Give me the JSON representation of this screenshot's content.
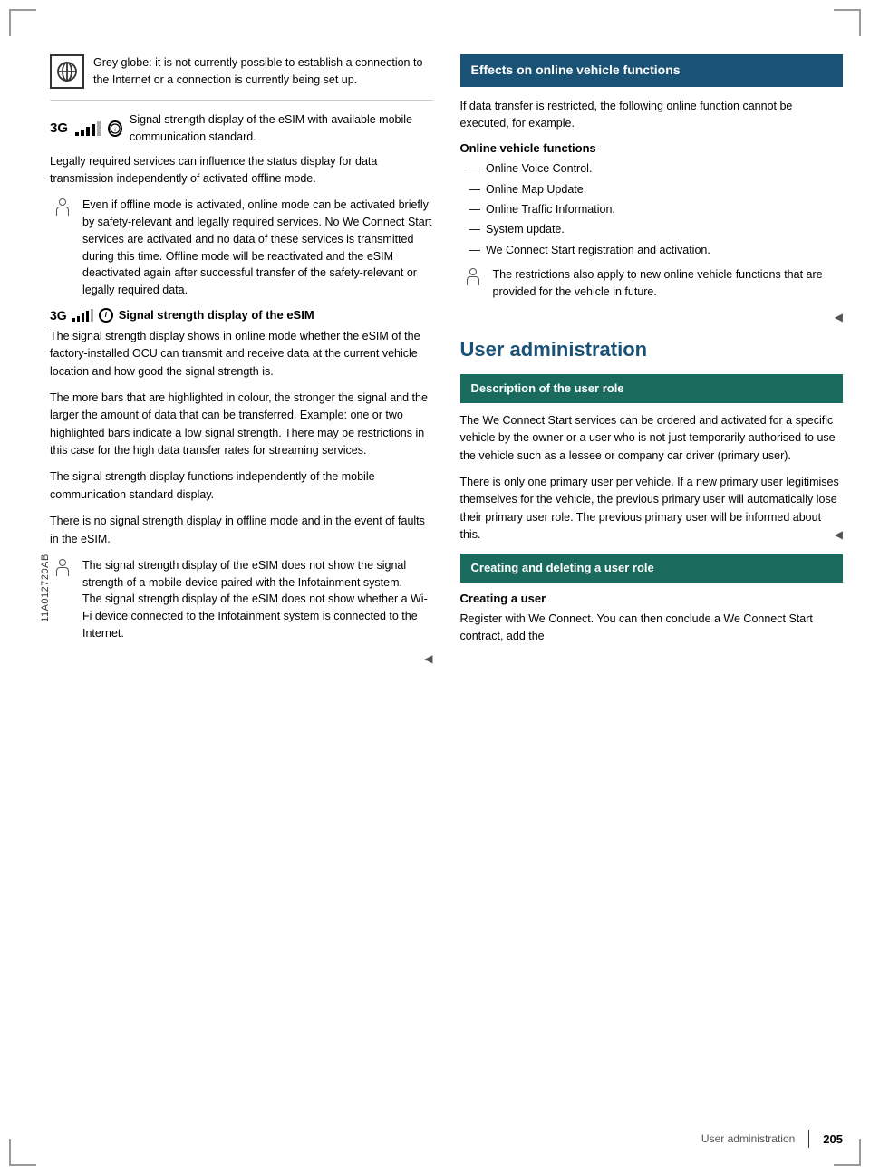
{
  "page": {
    "number": "205",
    "footer_section": "User administration",
    "sidebar_label": "11A012720AB"
  },
  "left_col": {
    "grey_globe_text": "Grey globe: it is not currently possible to establish a connection to the Internet or a connection is currently being set up.",
    "signal_label": "3G",
    "signal_desc": "Signal strength display of the eSIM with available mobile communication standard.",
    "legally_text": "Legally required services can influence the status display for data transmission independently of activated offline mode.",
    "note1_text": "Even if offline mode is activated, online mode can be activated briefly by safety-relevant and legally required services. No We Connect Start services are activated and no data of these services is transmitted during this time. Offline mode will be reactivated and the eSIM deactivated again after successful transfer of the safety-relevant or legally required data.",
    "signal_section_heading": "Signal strength display of the eSIM",
    "signal_body1": "The signal strength display shows in online mode whether the eSIM of the factory-installed OCU can transmit and receive data at the current vehicle location and how good the signal strength is.",
    "signal_body2": "The more bars that are highlighted in colour, the stronger the signal and the larger the amount of data that can be transferred. Example: one or two highlighted bars indicate a low signal strength. There may be restrictions in this case for the high data transfer rates for streaming services.",
    "signal_body3": "The signal strength display functions independently of the mobile communication standard display.",
    "signal_body4": "There is no signal strength display in offline mode and in the event of faults in the eSIM.",
    "note2_text": "The signal strength display of the eSIM does not show the signal strength of a mobile device paired with the Infotainment system.\nThe signal strength display of the eSIM does not show whether a Wi-Fi device connected to the Infotainment system is connected to the Internet."
  },
  "right_col": {
    "effects_heading": "Effects on online vehicle functions",
    "effects_intro": "If data transfer is restricted, the following online function cannot be executed, for example.",
    "online_functions_heading": "Online vehicle functions",
    "online_functions": [
      "Online Voice Control.",
      "Online Map Update.",
      "Online Traffic Information.",
      "System update.",
      "We Connect Start registration and activation."
    ],
    "restrictions_note": "The restrictions also apply to new online vehicle functions that are provided for the vehicle in future.",
    "user_admin_title": "User administration",
    "desc_role_heading": "Description of the user role",
    "desc_role_body1": "The We Connect Start services can be ordered and activated for a specific vehicle by the owner or a user who is not just temporarily authorised to use the vehicle such as a lessee or company car driver (primary user).",
    "desc_role_body2": "There is only one primary user per vehicle. If a new primary user legitimises themselves for the vehicle, the previous primary user will automatically lose their primary user role. The previous primary user will be informed about this.",
    "creating_heading": "Creating and deleting a user role",
    "creating_user_subheading": "Creating a user",
    "creating_user_body": "Register with We Connect. You can then conclude a We Connect Start contract, add the"
  }
}
